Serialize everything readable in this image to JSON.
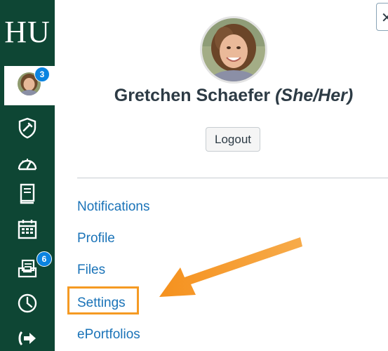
{
  "global_nav": {
    "logo_text": "HU",
    "account_badge": "3",
    "inbox_badge": "6",
    "items": [
      {
        "icon": "account-avatar"
      },
      {
        "icon": "admin-shield-icon"
      },
      {
        "icon": "dashboard-icon"
      },
      {
        "icon": "courses-icon"
      },
      {
        "icon": "calendar-icon"
      },
      {
        "icon": "inbox-icon"
      },
      {
        "icon": "history-clock-icon"
      },
      {
        "icon": "help-arrow-icon"
      }
    ],
    "colors": {
      "background": "#0e4634",
      "badge": "#0b84e0"
    }
  },
  "tray": {
    "close_label": "✕",
    "user_name": "Gretchen Schaefer",
    "pronouns": "(She/Her)",
    "logout_label": "Logout",
    "links": [
      {
        "label": "Notifications"
      },
      {
        "label": "Profile"
      },
      {
        "label": "Files"
      },
      {
        "label": "Settings"
      },
      {
        "label": "ePortfolios"
      }
    ],
    "colors": {
      "link": "#1a73b8",
      "highlight": "#f59a23",
      "text": "#2d3b45"
    }
  }
}
